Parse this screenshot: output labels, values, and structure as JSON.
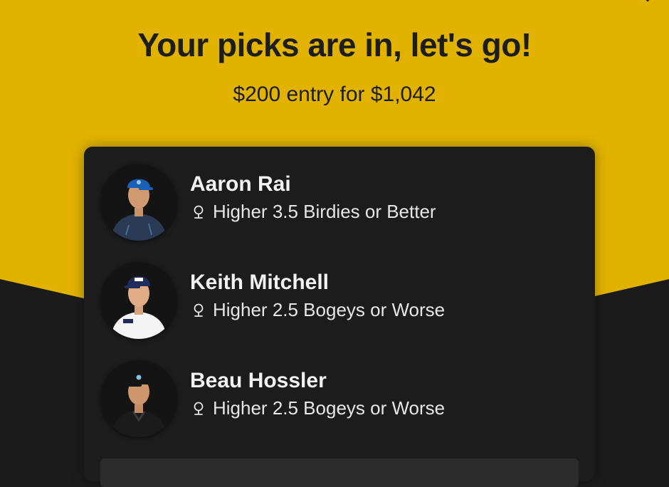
{
  "header": {
    "title": "Your picks are in, let's go!",
    "entry_summary": "$200 entry for $1,042"
  },
  "picks": [
    {
      "player": "Aaron Rai",
      "pick": "Higher 3.5 Birdies or Better",
      "icon": "golf-pin-icon",
      "avatar_colors": {
        "cap": "#1a5fb4",
        "shirt": "#2a3a55"
      }
    },
    {
      "player": "Keith Mitchell",
      "pick": "Higher 2.5 Bogeys or Worse",
      "icon": "golf-pin-icon",
      "avatar_colors": {
        "cap": "#1f2c5c",
        "shirt": "#f4f4f4"
      }
    },
    {
      "player": "Beau Hossler",
      "pick": "Higher 2.5 Bogeys or Worse",
      "icon": "golf-pin-icon",
      "avatar_colors": {
        "cap": "#141414",
        "shirt": "#1a1a1a"
      }
    }
  ],
  "theme": {
    "accent": "#e1b300",
    "card_bg": "#1c1c1d",
    "text_dark": "#1d1d1d",
    "text_light": "#f2f2f2"
  }
}
